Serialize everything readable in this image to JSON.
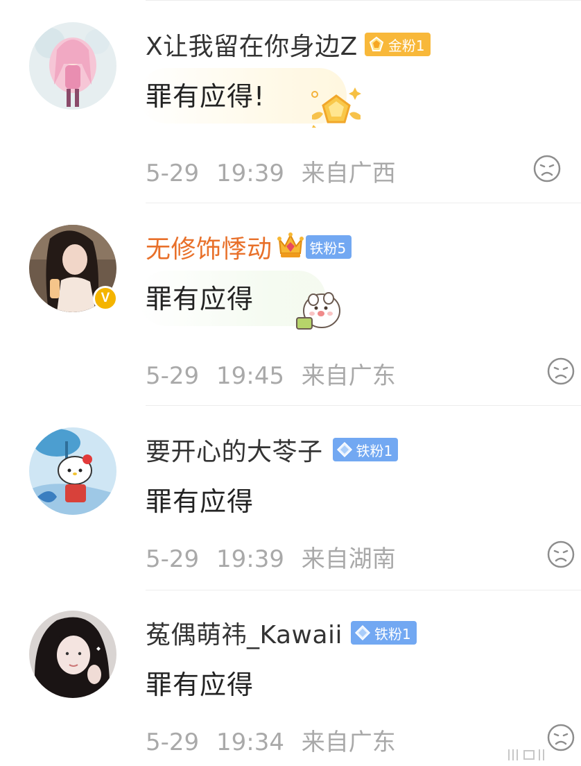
{
  "comments": [
    {
      "username": "X让我留在你身边Z",
      "badge_text": "金粉1",
      "content": "罪有应得!",
      "date": "5-29",
      "time": "19:39",
      "location": "来自广西"
    },
    {
      "username": "无修饰悸动",
      "badge_text": "铁粉5",
      "content": "罪有应得",
      "date": "5-29",
      "time": "19:45",
      "location": "来自广东",
      "verified_label": "V"
    },
    {
      "username": "要开心的大苓子",
      "badge_text": "铁粉1",
      "content": "罪有应得",
      "date": "5-29",
      "time": "19:39",
      "location": "来自湖南"
    },
    {
      "username": "菟偶萌祎_Kawaii",
      "badge_text": "铁粉1",
      "content": "罪有应得",
      "date": "5-29",
      "time": "19:34",
      "location": "来自广东"
    }
  ],
  "icons": {
    "mood": "sad-face-icon",
    "gold_badge": "gold-gem-icon",
    "iron_badge": "diamond-icon",
    "crown": "crown-icon"
  },
  "colors": {
    "vip_name": "#e8702a",
    "gold_badge": "#f8b83a",
    "iron_badge": "#72a8f2",
    "meta_text": "#a9a9a9",
    "verified": "#f4b400"
  }
}
